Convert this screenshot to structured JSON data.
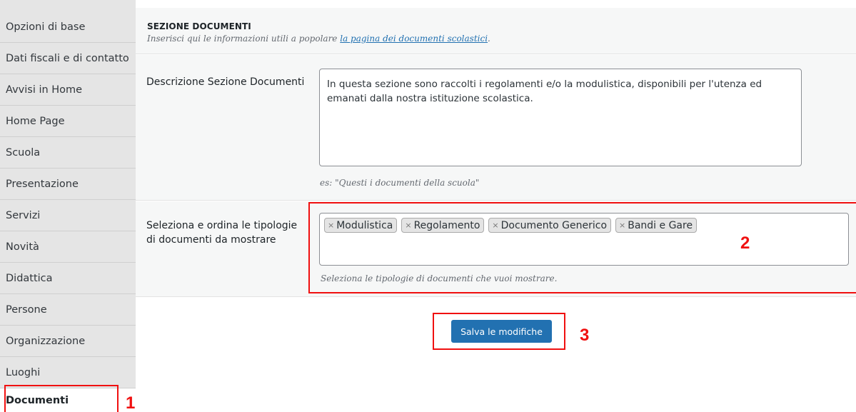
{
  "sidebar": {
    "items": [
      {
        "label": "Opzioni di base"
      },
      {
        "label": "Dati fiscali e di contatto"
      },
      {
        "label": "Avvisi in Home"
      },
      {
        "label": "Home Page"
      },
      {
        "label": "Scuola"
      },
      {
        "label": "Presentazione"
      },
      {
        "label": "Servizi"
      },
      {
        "label": "Novità"
      },
      {
        "label": "Didattica"
      },
      {
        "label": "Persone"
      },
      {
        "label": "Organizzazione"
      },
      {
        "label": "Luoghi"
      },
      {
        "label": "Documenti",
        "active": true
      }
    ]
  },
  "section": {
    "title": "SEZIONE DOCUMENTI",
    "description_prefix": "Inserisci qui le informazioni utili a popolare ",
    "description_link": "la pagina dei documenti scolastici",
    "description_suffix": "."
  },
  "description_field": {
    "label": "Descrizione Sezione Documenti",
    "value": "In questa sezione sono raccolti i regolamenti e/o la modulistica, disponibili per l'utenza ed emanati dalla nostra istituzione scolastica.",
    "help": "es: \"Questi i documenti della scuola\""
  },
  "types_field": {
    "label": "Seleziona e ordina le tipologie di documenti da mostrare",
    "remove_symbol": "×",
    "tags": [
      "Modulistica",
      "Regolamento",
      "Documento Generico",
      "Bandi e Gare"
    ],
    "help": "Seleziona le tipologie di documenti che vuoi mostrare."
  },
  "save_button": {
    "label": "Salva le modifiche"
  },
  "annotations": {
    "n1": "1",
    "n2": "2",
    "n3": "3",
    "color": "#f01010"
  },
  "colors": {
    "primary": "#2271b1",
    "sidebar_bg": "#e5e5e5",
    "panel_bg": "#f6f7f7"
  }
}
